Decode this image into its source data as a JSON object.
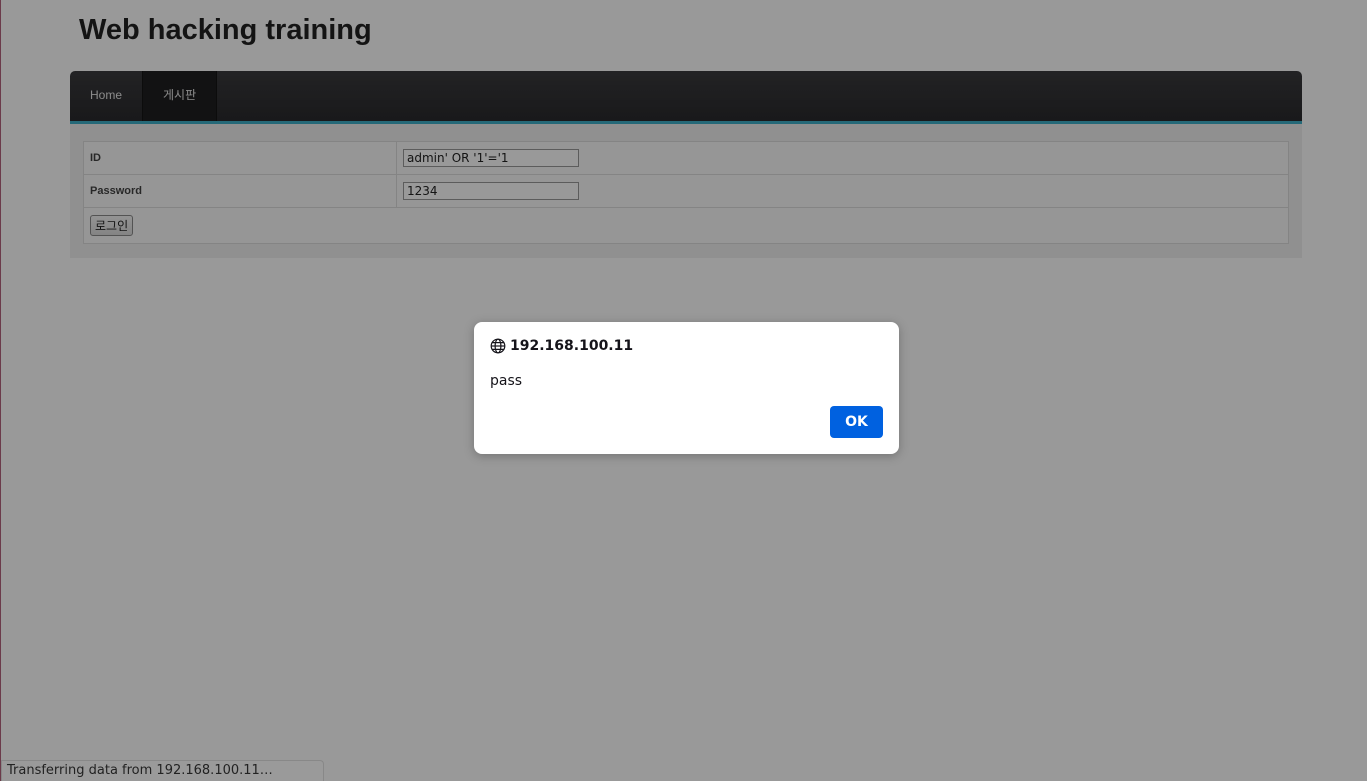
{
  "site": {
    "title": "Web hacking training"
  },
  "nav": {
    "items": [
      {
        "label": "Home"
      },
      {
        "label": "게시판"
      }
    ]
  },
  "login_form": {
    "id_label": "ID",
    "id_value": "admin' OR '1'='1",
    "password_label": "Password",
    "password_value": "1234",
    "submit_label": "로그인"
  },
  "alert_dialog": {
    "origin": "192.168.100.11",
    "message": "pass",
    "ok_label": "OK",
    "icon": "globe-icon",
    "button_color": "#0061e0"
  },
  "status_bar": {
    "text": "Transferring data from 192.168.100.11…"
  },
  "colors": {
    "navbar_accent": "#3fb0c8",
    "navbar_bg": "#2a2a2d"
  }
}
